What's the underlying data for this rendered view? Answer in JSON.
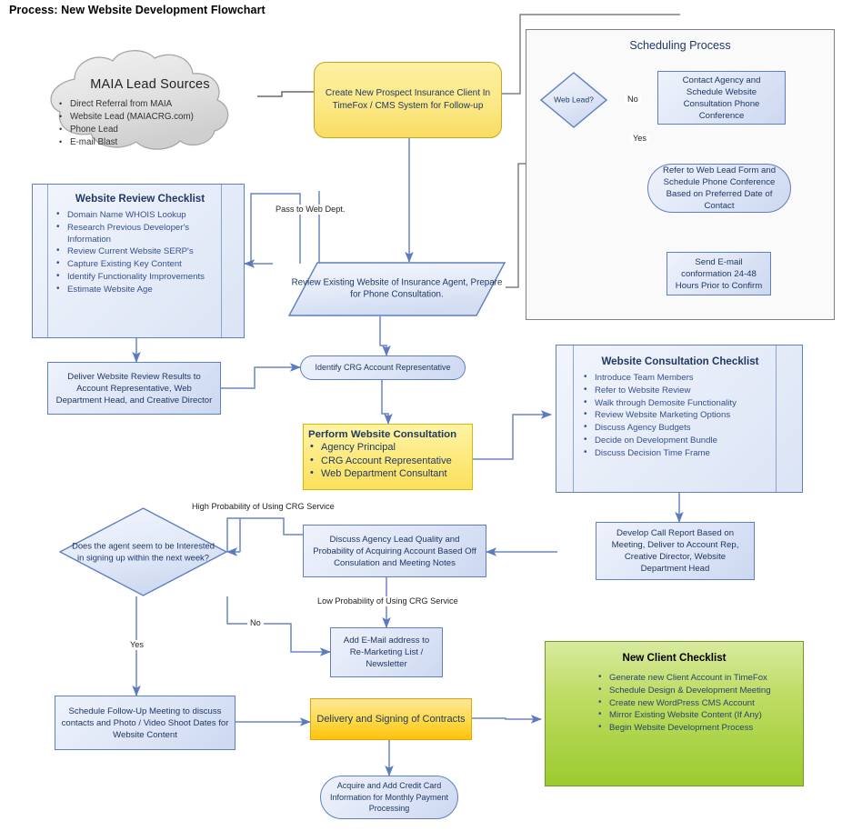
{
  "page": {
    "title": "Process: New Website Development Flowchart"
  },
  "colors": {
    "blue_fill": "#dde5f6",
    "blue_stroke": "#5f7fc0",
    "yellow_fill": "#fbe05c",
    "gold_fill": "#ffd945",
    "green_fill": "#9ccb2f",
    "connector_blue": "#6a86c4",
    "connector_gray": "#808080",
    "text_navy": "#1f3864"
  },
  "nodes": {
    "cloud": {
      "heading": "MAIA Lead Sources",
      "items": [
        "Direct Referral from MAIA",
        "Website Lead (MAIACRG.com)",
        "Phone Lead",
        "E-mail Blast"
      ]
    },
    "create_prospect": "Create New Prospect Insurance Client In TimeFox / CMS System for Follow-up",
    "scheduling_group": "Scheduling Process",
    "web_lead_decision": "Web Lead?",
    "contact_agency": "Contact Agency and Schedule Website Consultation Phone Conference",
    "refer_web_lead": "Refer to Web Lead Form and Schedule Phone Conference Based on Preferred Date of Contact",
    "send_email": "Send E-mail conformation 24-48 Hours Prior to Confirm",
    "website_review_checklist": {
      "heading": "Website Review Checklist",
      "items": [
        "Domain Name WHOIS Lookup",
        "Research Previous Developer's Information",
        "Review Current Website SERP's",
        "Capture Existing Key Content",
        "Identify Functionality Improvements",
        "Estimate Website Age"
      ]
    },
    "review_existing": "Review Existing Website of Insurance Agent,  Prepare for Phone Consultation.",
    "deliver_results": "Deliver Website Review Results to Account Representative, Web Department Head, and Creative Director",
    "identify_crg": "Identify CRG Account Representative",
    "perform_consultation": {
      "heading": "Perform Website Consultation",
      "items": [
        "Agency Principal",
        "CRG Account Representative",
        "Web Department Consultant"
      ]
    },
    "consultation_checklist": {
      "heading": "Website Consultation Checklist",
      "items": [
        "Introduce Team Members",
        "Refer to Website Review",
        "Walk through Demosite Functionality",
        "Review Website Marketing Options",
        "Discuss Agency Budgets",
        "Decide on Development Bundle",
        "Discuss Decision Time Frame"
      ]
    },
    "develop_call_report": "Develop Call Report Based on Meeting, Deliver to Account Rep, Creative Director, Website Department Head",
    "discuss_lead_quality": "Discuss Agency Lead Quality and Probability of Acquiring Account Based Off Consulation and Meeting Notes",
    "agent_interest_decision": "Does the agent seem to be Interested in signing  up within the next week?",
    "add_email_remarketing": "Add E-Mail address to Re-Marketing List / Newsletter",
    "schedule_followup": "Schedule Follow-Up Meeting to discuss contacts and Photo / Video Shoot Dates for Website Content",
    "delivery_signing": "Delivery and Signing of Contracts",
    "acquire_credit_card": "Acquire and Add Credit Card Information for Monthly Payment Processing",
    "new_client_checklist": {
      "heading": "New Client Checklist",
      "items": [
        "Generate new Client Account in TimeFox",
        "Schedule Design & Development Meeting",
        "Create new WordPress CMS Account",
        "Mirror Existing Website Content (If Any)",
        "Begin Website Development Process"
      ]
    }
  },
  "edge_labels": {
    "no_web_lead": "No",
    "yes_web_lead": "Yes",
    "pass_to_web_dept": "Pass to Web Dept.",
    "high_probability": "High Probability of Using CRG Service",
    "low_probability": "Low Probability of Using CRG Service",
    "no_interest": "No",
    "yes_interest": "Yes"
  }
}
